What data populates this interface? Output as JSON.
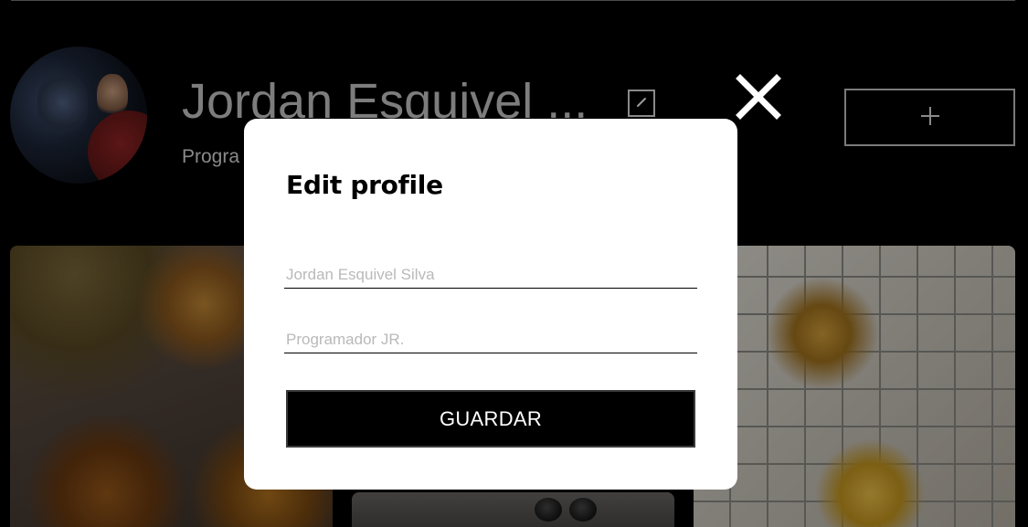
{
  "profile": {
    "name": "Jordan Esquivel ...",
    "role": "Progra"
  },
  "icons": {
    "edit": "pencil-icon",
    "close": "close-icon",
    "add": "plus-icon"
  },
  "modal": {
    "title": "Edit profile",
    "name_placeholder": "Jordan Esquivel Silva",
    "role_placeholder": "Programador JR.",
    "save_label": "GUARDAR"
  },
  "colors": {
    "background": "#000000",
    "modal_bg": "#ffffff",
    "button_bg": "#000000",
    "placeholder": "#b9b9b9"
  }
}
